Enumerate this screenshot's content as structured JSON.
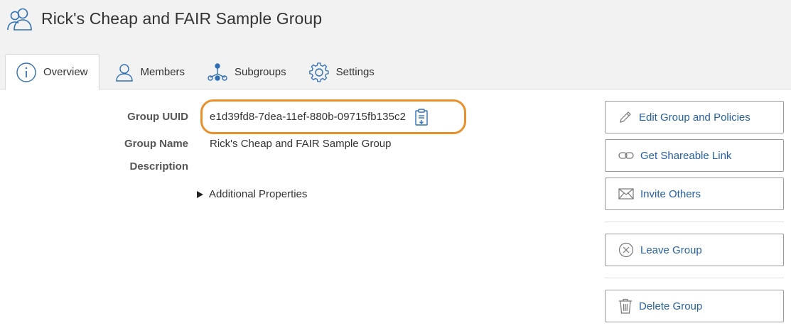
{
  "header": {
    "title": "Rick's Cheap and FAIR Sample Group",
    "icon": "group-users-icon"
  },
  "tabs": [
    {
      "label": "Overview",
      "icon": "info-circle-icon",
      "active": true
    },
    {
      "label": "Members",
      "icon": "user-icon",
      "active": false
    },
    {
      "label": "Subgroups",
      "icon": "subgroups-tree-icon",
      "active": false
    },
    {
      "label": "Settings",
      "icon": "gear-icon",
      "active": false
    }
  ],
  "details": {
    "uuid_label": "Group UUID",
    "uuid_value": "e1d39fd8-7dea-11ef-880b-09715fb135c2",
    "name_label": "Group Name",
    "name_value": "Rick's Cheap and FAIR Sample Group",
    "description_label": "Description",
    "description_value": "",
    "additional_properties": "Additional Properties"
  },
  "actions": {
    "edit": "Edit Group and Policies",
    "share_link": "Get Shareable Link",
    "invite": "Invite Others",
    "leave": "Leave Group",
    "delete": "Delete Group"
  },
  "colors": {
    "accent_link": "#27609f",
    "highlight_ring": "#e8912b",
    "header_bg": "#f2f2f2"
  }
}
